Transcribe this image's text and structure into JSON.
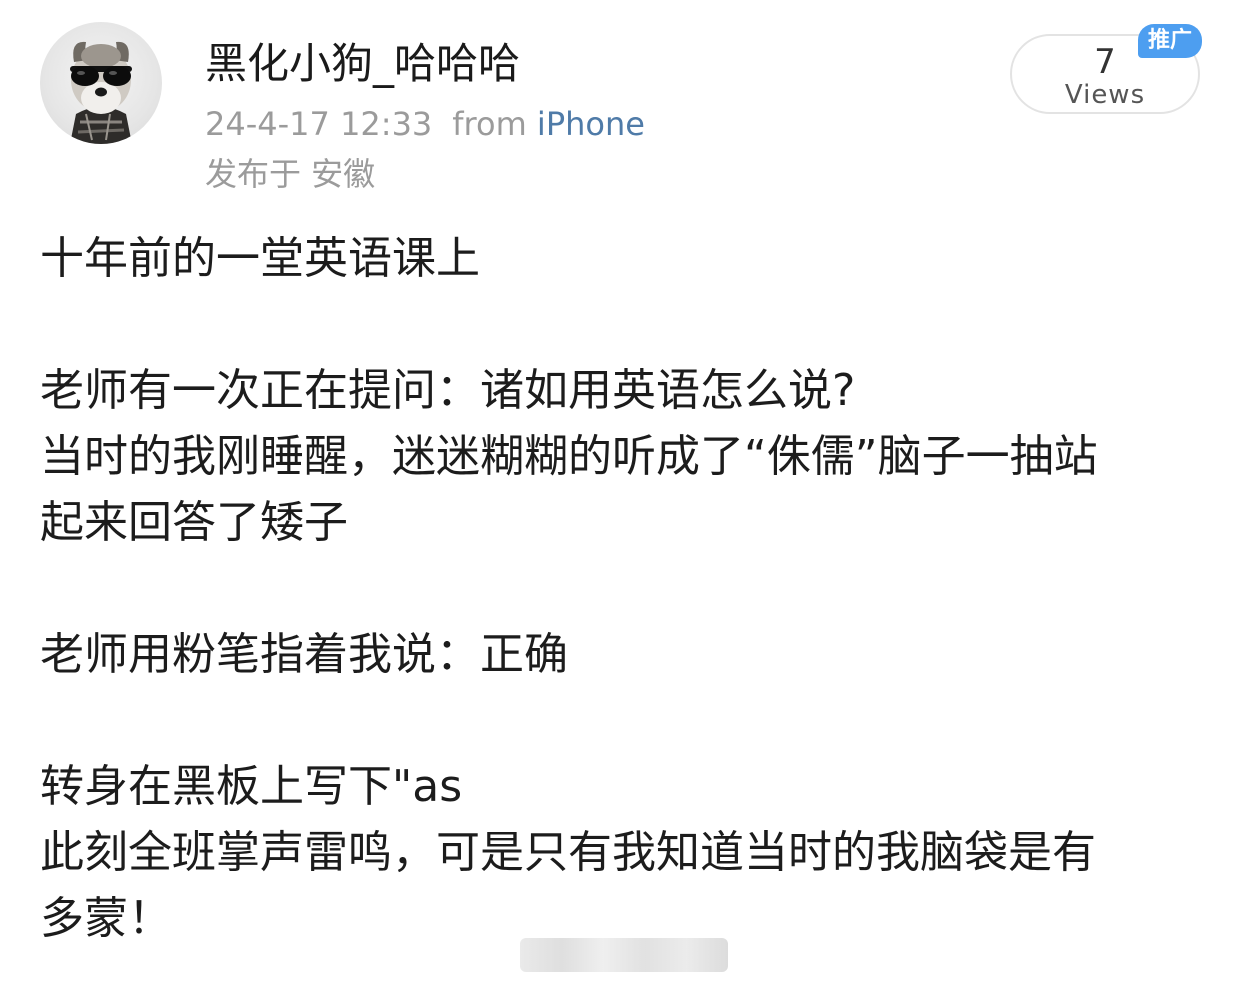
{
  "author": {
    "username": "黑化小狗_哈哈哈",
    "avatar_icon": "dog-with-sunglasses-avatar"
  },
  "meta": {
    "datetime": "24-4-17 12:33",
    "from_label": "from",
    "device": "iPhone",
    "location": "发布于 安徽"
  },
  "views": {
    "count": "7",
    "label": "Views",
    "ad_badge": "推广"
  },
  "post": {
    "line1": "十年前的一堂英语课上",
    "line2": "老师有一次正在提问：诸如用英语怎么说?",
    "line3": "当时的我刚睡醒，迷迷糊糊的听成了“侏儒”脑子一抽站",
    "line4": "起来回答了矮子",
    "line5": "老师用粉笔指着我说：正确",
    "line6": "转身在黑板上写下\"as",
    "line7": "此刻全班掌声雷鸣，可是只有我知道当时的我脑袋是有",
    "line8": "多蒙！"
  },
  "colors": {
    "link_blue": "#4f7ba8",
    "badge_blue": "#4d9ef0",
    "meta_gray": "#9b9b9b"
  }
}
